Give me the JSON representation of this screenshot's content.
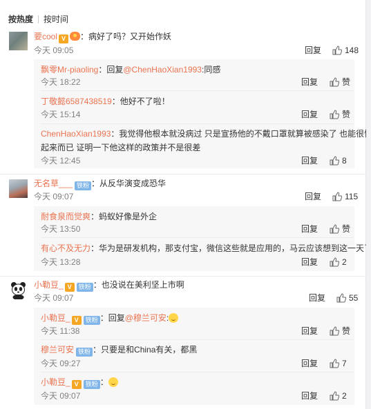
{
  "sort": {
    "hot": "按热度",
    "time": "按时间"
  },
  "labels": {
    "reply": "回复",
    "like": "赞"
  },
  "comments": [
    {
      "user": "要cool",
      "text": "：病好了吗？又开始作妖",
      "time": "今天 09:05",
      "likes": "148",
      "replies": [
        {
          "user": "飘零Mr-piaoling",
          "text_pre": "：回复",
          "at": "@ChenHaoXian1993",
          "text": ":同感",
          "time": "今天 18:22",
          "likes": "赞"
        },
        {
          "user": "丁敬懿6587438519",
          "text_pre": "",
          "at": "",
          "text": "：他好不了啦！",
          "time": "今天 15:14",
          "likes": "赞"
        },
        {
          "user": "ChenHaoXian1993",
          "text_pre": "",
          "at": "",
          "text": "：我觉得他根本就没病过 只是宣扬他的不戴口罩就算被感染了 也能很快好",
          "text2": "起来而已 证明一下他这样的政策并不是很差",
          "time": "今天 12:45",
          "likes": "8"
        }
      ]
    },
    {
      "user": "无名草___",
      "badge": "铁粉",
      "text": "：从反华演变成恐华",
      "time": "今天 09:07",
      "likes": "115",
      "replies": [
        {
          "user": "耐食泉而觉爽",
          "text": "：蚂蚁好像是外企",
          "time": "今天 13:50",
          "likes": "赞"
        },
        {
          "user": "有心不及无力",
          "text": "：华为是研发机构，那支付宝，微信这些就是应用的，马云应该想到这一天了",
          "time": "今天 13:28",
          "likes": "2"
        }
      ]
    },
    {
      "user": "小勒豆_",
      "badge": "铁粉",
      "text": "：也没说在美利坚上市啊",
      "time": "今天 09:07",
      "likes": "55",
      "replies": [
        {
          "user": "小勒豆_",
          "badge": "铁粉",
          "text_pre": "：回复",
          "at": "@穆兰可安",
          "text": ":",
          "time": "今天 11:38",
          "likes": "赞"
        },
        {
          "user": "穆兰可安",
          "badge": "铁粉",
          "text": "：只要是和China有关，都黑",
          "time": "今天 09:27",
          "likes": "7"
        },
        {
          "user": "小勒豆_",
          "badge": "铁粉",
          "text": "：",
          "time": "今天 09:07",
          "likes": "2"
        }
      ]
    }
  ]
}
